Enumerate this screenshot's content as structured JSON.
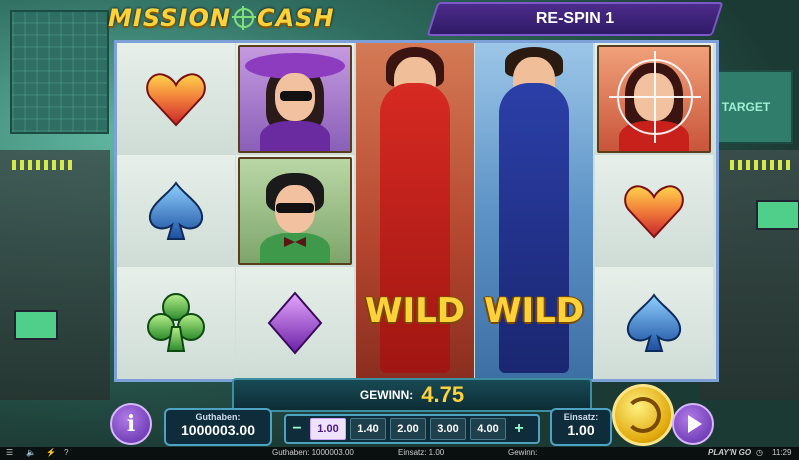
{
  "game": {
    "logo_text_1": "MISSION",
    "logo_text_2": "CASH",
    "respin_text": "RE-SPIN 1"
  },
  "reels": {
    "columns": [
      [
        "heart",
        "spade",
        "club"
      ],
      [
        "woman-in-purple-hat",
        "man-with-glasses",
        "diamond"
      ],
      [
        "wild-female-agent"
      ],
      [
        "wild-male-agent"
      ],
      [
        "woman-in-crosshair",
        "heart",
        "spade"
      ]
    ],
    "wild_label": "WILD",
    "background_sign": "TARGET"
  },
  "win": {
    "label": "GEWINN:",
    "value": "4.75"
  },
  "balance": {
    "label": "Guthaben:",
    "value": "1000003.00"
  },
  "bet": {
    "options": [
      "1.00",
      "1.40",
      "2.00",
      "3.00",
      "4.00"
    ],
    "selected": "1.00",
    "minus": "−",
    "plus": "+"
  },
  "stake": {
    "label": "Einsatz:",
    "value": "1.00"
  },
  "buttons": {
    "info": "i"
  },
  "status_bar": {
    "guthaben": "Guthaben: 1000003.00",
    "einsatz": "Einsatz: 1.00",
    "gewinn": "Gewinn:",
    "brand": "PLAY'N GO",
    "time": "11:29",
    "help": "?"
  },
  "colors": {
    "gold": "#ffd23a",
    "purple": "#5b2aa5",
    "panel": "#0f2c3a"
  }
}
